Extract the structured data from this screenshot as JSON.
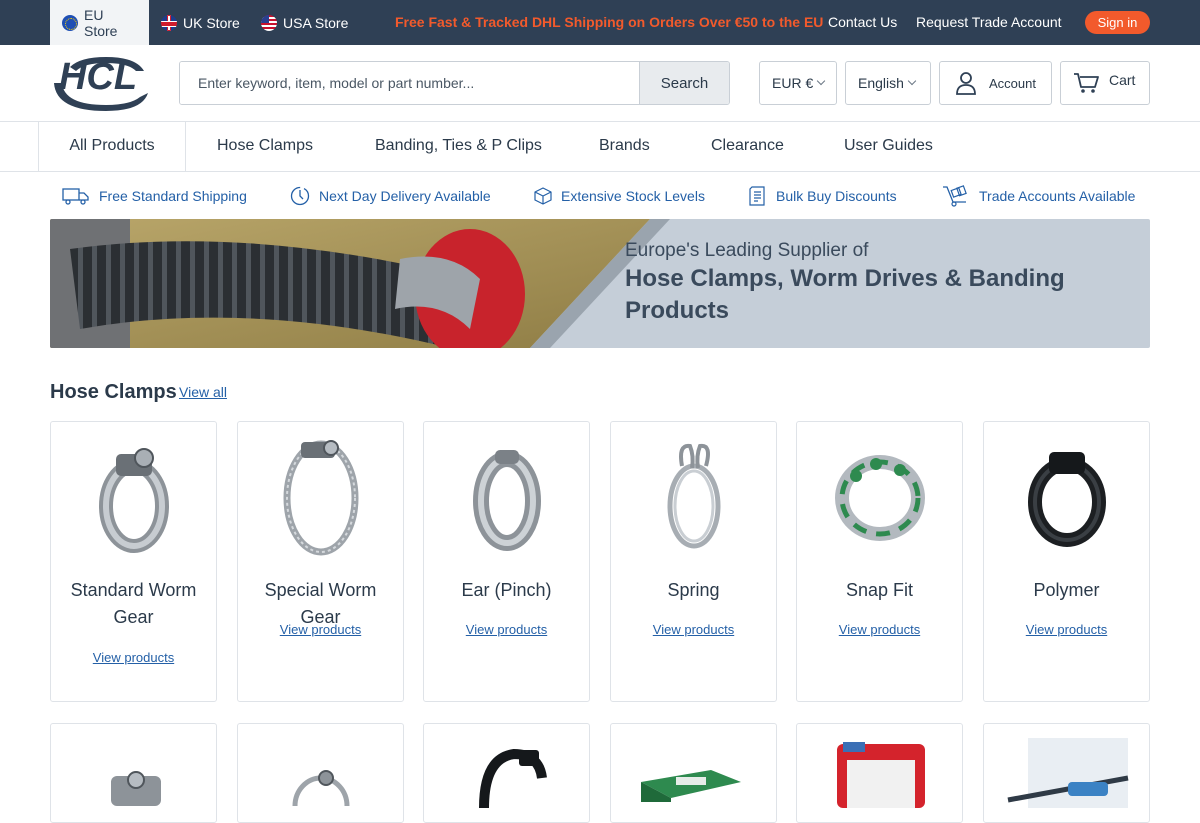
{
  "topbar": {
    "stores": [
      "EU Store",
      "UK Store",
      "USA Store"
    ],
    "promo": "Free Fast & Tracked DHL Shipping on Orders Over €50 to the EU",
    "contact": "Contact Us",
    "trade": "Request Trade Account",
    "signin": "Sign in",
    "promo_color": "#f25a2c",
    "bar_color": "#2f4055"
  },
  "header": {
    "logo_text": "HCL",
    "search_placeholder": "Enter keyword, item, model or part number...",
    "search_button": "Search",
    "currency": "EUR €",
    "language": "English",
    "account": "Account",
    "cart": "Cart"
  },
  "nav": {
    "items": [
      "All Products",
      "Hose Clamps",
      "Banding, Ties & P Clips",
      "Brands",
      "Clearance",
      "User Guides"
    ]
  },
  "features": [
    {
      "label": "Free Standard Shipping",
      "icon": "truck-icon"
    },
    {
      "label": "Next Day Delivery Available",
      "icon": "clock-icon"
    },
    {
      "label": "Extensive Stock Levels",
      "icon": "box-icon"
    },
    {
      "label": "Bulk Buy Discounts",
      "icon": "document-icon"
    },
    {
      "label": "Trade Accounts Available",
      "icon": "trolley-icon"
    }
  ],
  "banner": {
    "subtitle": "Europe's Leading Supplier of",
    "title": "Hose Clamps, Worm Drives & Banding Products"
  },
  "section": {
    "title": "Hose Clamps",
    "view_all": "View all"
  },
  "categories": [
    {
      "name": "Standard Worm Gear",
      "link": "View products"
    },
    {
      "name": "Special Worm Gear",
      "link": "View products"
    },
    {
      "name": "Ear (Pinch)",
      "link": "View products"
    },
    {
      "name": "Spring",
      "link": "View products"
    },
    {
      "name": "Snap Fit",
      "link": "View products"
    },
    {
      "name": "Polymer",
      "link": "View products"
    }
  ]
}
